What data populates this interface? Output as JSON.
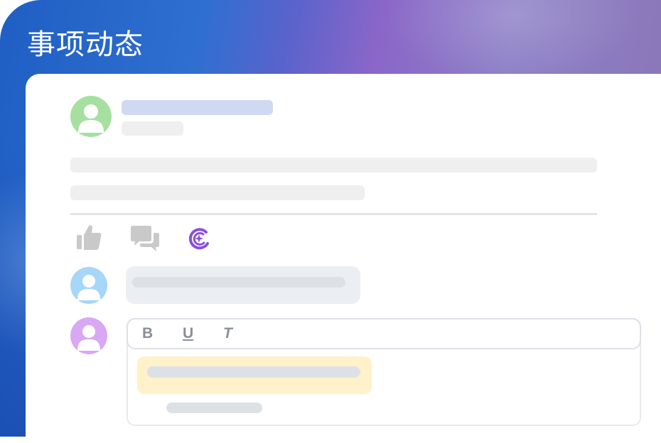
{
  "header": {
    "title": "事项动态"
  },
  "colors": {
    "accent_purple": "#8a4fe0",
    "avatar_green": "#a6e0a0",
    "avatar_blue": "#a6d6f8",
    "avatar_purple": "#d8a8f4",
    "placeholder_gray": "#efefef",
    "placeholder_blue": "#cfd9f2",
    "highlight_yellow": "#fff1c9"
  },
  "post": {
    "avatar_icon": "user-avatar-icon"
  },
  "actions": {
    "like_icon": "thumbs-up-icon",
    "comment_icon": "chat-bubbles-icon",
    "ai_icon": "ai-sparkle-icon"
  },
  "editor": {
    "bold_label": "B",
    "underline_label": "U",
    "italic_label": "T"
  }
}
